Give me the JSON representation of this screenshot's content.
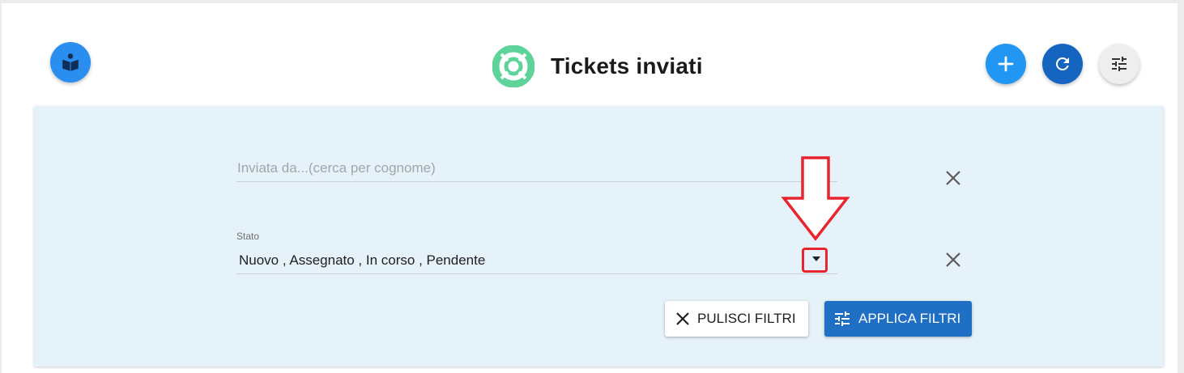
{
  "header": {
    "title": "Tickets inviati",
    "left_button_icon": "book-reader-icon",
    "title_icon": "life-ring-icon",
    "actions": [
      {
        "name": "add-button",
        "icon": "plus-icon",
        "color": "#2196f3"
      },
      {
        "name": "refresh-button",
        "icon": "refresh-icon",
        "color": "#1565c0"
      },
      {
        "name": "filters-toggle-button",
        "icon": "tune-icon",
        "color": "#eeeeee"
      }
    ]
  },
  "filters": {
    "sender": {
      "placeholder": "Inviata da...(cerca per cognome)",
      "value": ""
    },
    "status": {
      "label": "Stato",
      "value": "Nuovo , Assegnato , In corso , Pendente"
    },
    "clear_button_label": "PULISCI FILTRI",
    "apply_button_label": "APPLICA FILTRI"
  },
  "colors": {
    "panel_background": "#e5f2f9",
    "primary": "#1f6fc4",
    "accent_green": "#5ed49a",
    "annotation_red": "#e8252e"
  }
}
